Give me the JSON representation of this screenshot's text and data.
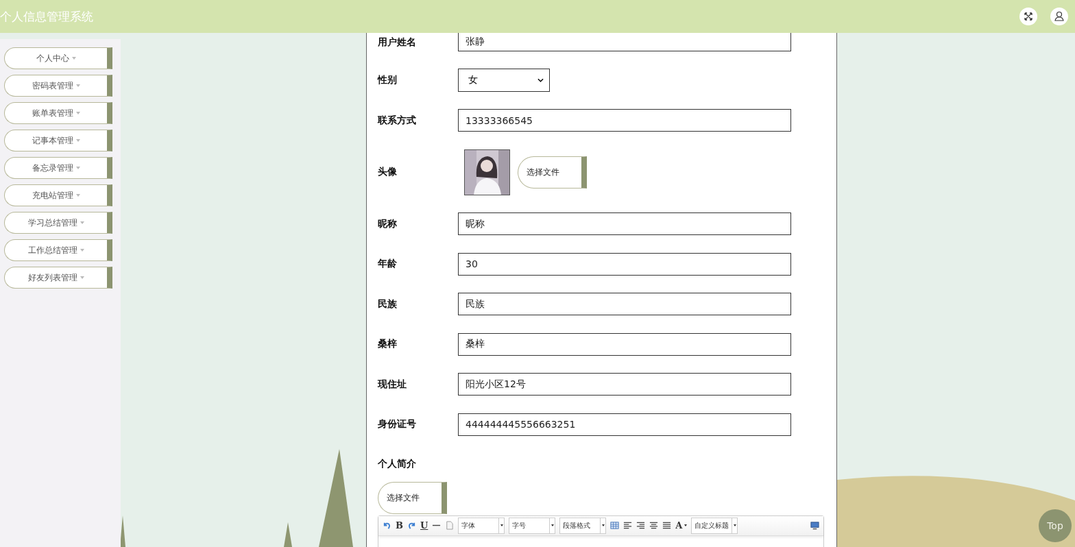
{
  "header": {
    "title": "个人信息管理系统"
  },
  "sidebar": {
    "items": [
      {
        "label": "个人中心"
      },
      {
        "label": "密码表管理"
      },
      {
        "label": "账单表管理"
      },
      {
        "label": "记事本管理"
      },
      {
        "label": "备忘录管理"
      },
      {
        "label": "充电站管理"
      },
      {
        "label": "学习总结管理"
      },
      {
        "label": "工作总结管理"
      },
      {
        "label": "好友列表管理"
      }
    ]
  },
  "form": {
    "fields": [
      {
        "kind": "text",
        "label": "用户姓名",
        "value": "张静"
      },
      {
        "kind": "select",
        "label": "性别",
        "value": "女"
      },
      {
        "kind": "text",
        "label": "联系方式",
        "value": "13333366545"
      },
      {
        "label": "头像",
        "button": "选择文件"
      },
      {
        "kind": "text",
        "label": "昵称",
        "value": "昵称"
      },
      {
        "kind": "text",
        "label": "年龄",
        "value": "30"
      },
      {
        "kind": "text",
        "label": "民族",
        "value": "民族"
      },
      {
        "kind": "text",
        "label": "桑梓",
        "value": "桑梓"
      },
      {
        "kind": "text",
        "label": "现住址",
        "value": "阳光小区12号"
      },
      {
        "kind": "text",
        "label": "身份证号",
        "value": "444444445556663251"
      }
    ],
    "bio": {
      "label": "个人简介",
      "button": "选择文件",
      "toolbar": [
        {
          "kind": "undo"
        },
        {
          "kind": "char",
          "label": "B"
        },
        {
          "kind": "redo"
        },
        {
          "kind": "char",
          "label": "U"
        },
        {
          "kind": "rule"
        },
        {
          "kind": "page"
        },
        {
          "kind": "dropdown",
          "label": "字体"
        },
        {
          "kind": "dropdown",
          "label": "字号"
        },
        {
          "kind": "dropdown",
          "label": "段落格式"
        },
        {
          "kind": "table"
        },
        {
          "kind": "align-left"
        },
        {
          "kind": "align-right"
        },
        {
          "kind": "align-center"
        },
        {
          "kind": "justify"
        },
        {
          "kind": "charmenu",
          "label": "A"
        },
        {
          "kind": "dropdown",
          "label": "自定义标题"
        },
        {
          "kind": "preview"
        }
      ]
    }
  },
  "top_button": {
    "label": "Top"
  }
}
